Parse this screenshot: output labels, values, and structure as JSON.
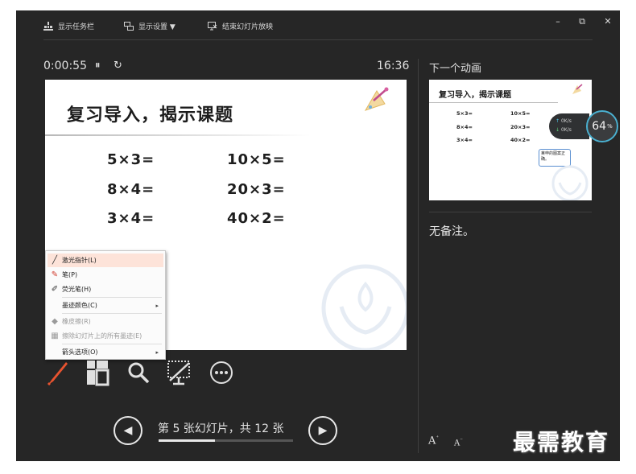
{
  "toolbar": {
    "show_taskbar": "显示任务栏",
    "display_settings": "显示设置 ▼",
    "end_slideshow": "结束幻灯片放映"
  },
  "window_controls": {
    "minimize": "–",
    "restore": "⧉",
    "close": "✕"
  },
  "presenter": {
    "elapsed": "0:00:55",
    "pause_glyph": "⏸",
    "restart_glyph": "↻",
    "clock": "16:36"
  },
  "slide": {
    "title": "复习导入，揭示课题",
    "problems": [
      {
        "left": "5×3=",
        "right": "10×5="
      },
      {
        "left": "8×4=",
        "right": "20×3="
      },
      {
        "left": "3×4=",
        "right": "40×2="
      }
    ]
  },
  "context_menu": {
    "items": [
      {
        "label": "激光指针(L)",
        "icon": "laser-pointer-icon",
        "disabled": false,
        "highlighted": true,
        "submenu": false
      },
      {
        "label": "笔(P)",
        "icon": "pen-icon",
        "disabled": false,
        "highlighted": false,
        "submenu": false
      },
      {
        "label": "荧光笔(H)",
        "icon": "highlighter-icon",
        "disabled": false,
        "highlighted": false,
        "submenu": false
      },
      {
        "label": "墨迹颜色(C)",
        "icon": "",
        "disabled": false,
        "highlighted": false,
        "submenu": true
      },
      {
        "label": "橡皮擦(R)",
        "icon": "eraser-icon",
        "disabled": true,
        "highlighted": false,
        "submenu": false
      },
      {
        "label": "擦除幻灯片上的所有墨迹(E)",
        "icon": "erase-all-icon",
        "disabled": true,
        "highlighted": false,
        "submenu": false
      },
      {
        "label": "箭头选项(O)",
        "icon": "",
        "disabled": false,
        "highlighted": false,
        "submenu": true
      }
    ],
    "submenu_arrow": "▸"
  },
  "navigation": {
    "prev_glyph": "◀",
    "next_glyph": "▶",
    "counter": "第 5 张幻灯片，共 12 张",
    "progress_fraction": 0.4167
  },
  "next_animation": {
    "label": "下一个动画",
    "title": "复习导入，揭示课题",
    "problems": [
      {
        "left": "5×3=",
        "right": "10×5="
      },
      {
        "left": "8×4=",
        "right": "20×3="
      },
      {
        "left": "3×4=",
        "right": "40×2="
      }
    ],
    "callout": "莱申的图案正确。"
  },
  "notes": {
    "text": "无备注。"
  },
  "font_controls": {
    "increase": "A",
    "decrease": "A"
  },
  "network": {
    "up": "0K/s",
    "down": "0K/s",
    "percent": "64",
    "percent_unit": "%"
  },
  "brand_watermark": "最需教育",
  "colors": {
    "background": "#262626",
    "accent_pen": "#e8532f",
    "menu_highlight": "#fde3d9"
  }
}
